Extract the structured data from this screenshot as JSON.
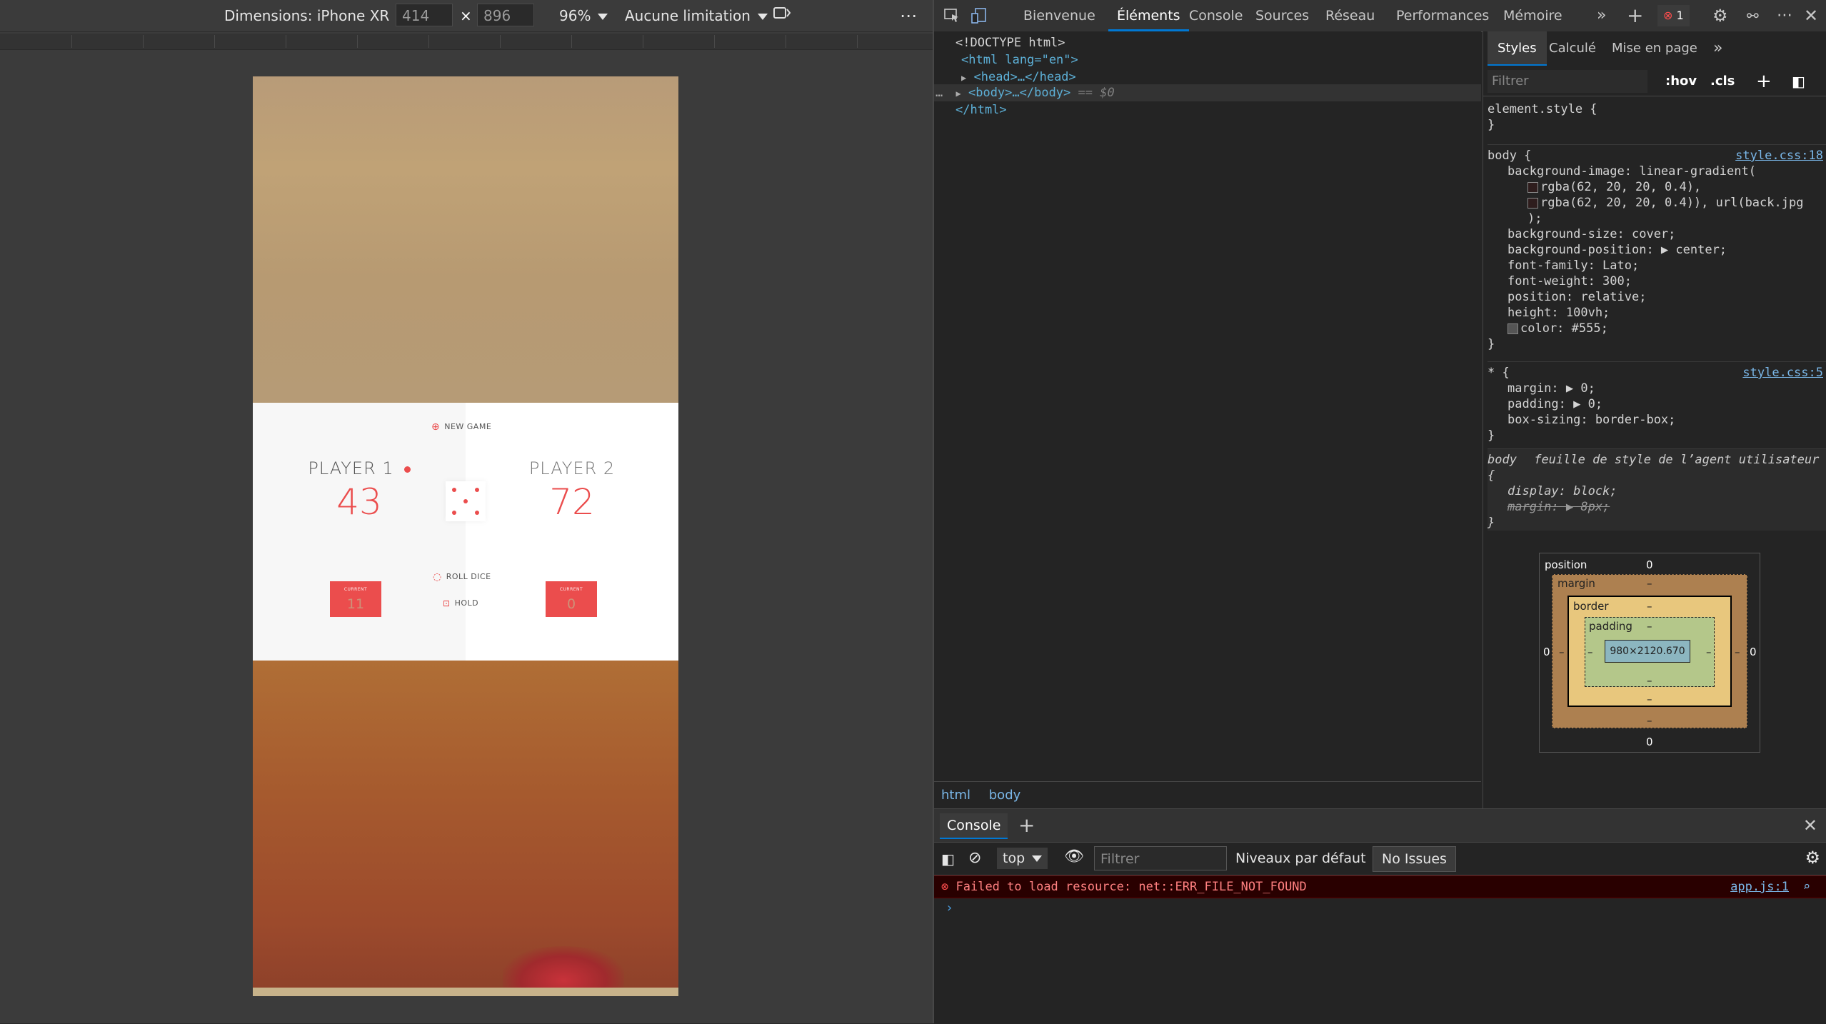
{
  "emulation": {
    "device_label": "Dimensions: iPhone XR",
    "width": "414",
    "height": "896",
    "zoom": "96%",
    "throttle": "Aucune limitation"
  },
  "game": {
    "new_game": "NEW GAME",
    "player1_name": "PLAYER 1",
    "player2_name": "PLAYER 2",
    "player1_score": "43",
    "player2_score": "72",
    "current_label": "CURRENT",
    "player1_current": "11",
    "player2_current": "0",
    "roll_dice": "ROLL DICE",
    "hold": "HOLD",
    "accent": "#eb4d4d"
  },
  "devtools": {
    "tabs": [
      "Bienvenue",
      "Éléments",
      "Console",
      "Sources",
      "Réseau",
      "Performances",
      "Mémoire"
    ],
    "error_count": "1",
    "dom": {
      "doctype": "<!DOCTYPE html>",
      "html_open": "<html lang=\"en\">",
      "head": "<head>…</head>",
      "body": "<body>…</body>",
      "body_suffix": "== $0",
      "html_close": "</html>"
    },
    "breadcrumb": [
      "html",
      "body"
    ],
    "styles_tabs": [
      "Styles",
      "Calculé",
      "Mise en page"
    ],
    "filter_placeholder": "Filtrer",
    "hov": ":hov",
    "cls": ".cls",
    "element_style": "element.style {",
    "body_rule": {
      "selector": "body {",
      "source": "style.css:18",
      "lines": [
        "background-image: linear-gradient(",
        "rgba(62, 20, 20, 0.4),",
        "rgba(62, 20, 20, 0.4)), url(back.jpg",
        ");",
        "background-size: cover;",
        "background-position: ▶ center;",
        "font-family: Lato;",
        "font-weight: 300;",
        "position: relative;",
        "height: 100vh;",
        "color: #555;"
      ]
    },
    "star_rule": {
      "selector": "* {",
      "source": "style.css:5",
      "lines": [
        "margin: ▶ 0;",
        "padding: ▶ 0;",
        "box-sizing: border-box;"
      ]
    },
    "ua_rule": {
      "selector": "body",
      "source": "feuille de style de l’agent utilisateur",
      "lines": [
        "display: block;",
        "margin: ▶ 8px;"
      ]
    },
    "boxmodel": {
      "position": "position",
      "margin": "margin",
      "border": "border",
      "padding": "padding",
      "content": "980×2120.670",
      "zero": "0",
      "dash": "–"
    },
    "console": {
      "tab": "Console",
      "context": "top",
      "filter": "Filtrer",
      "levels": "Niveaux par défaut",
      "issues": "No Issues",
      "error_message": "Failed to load resource: net::ERR_FILE_NOT_FOUND",
      "error_source": "app.js:1"
    }
  }
}
